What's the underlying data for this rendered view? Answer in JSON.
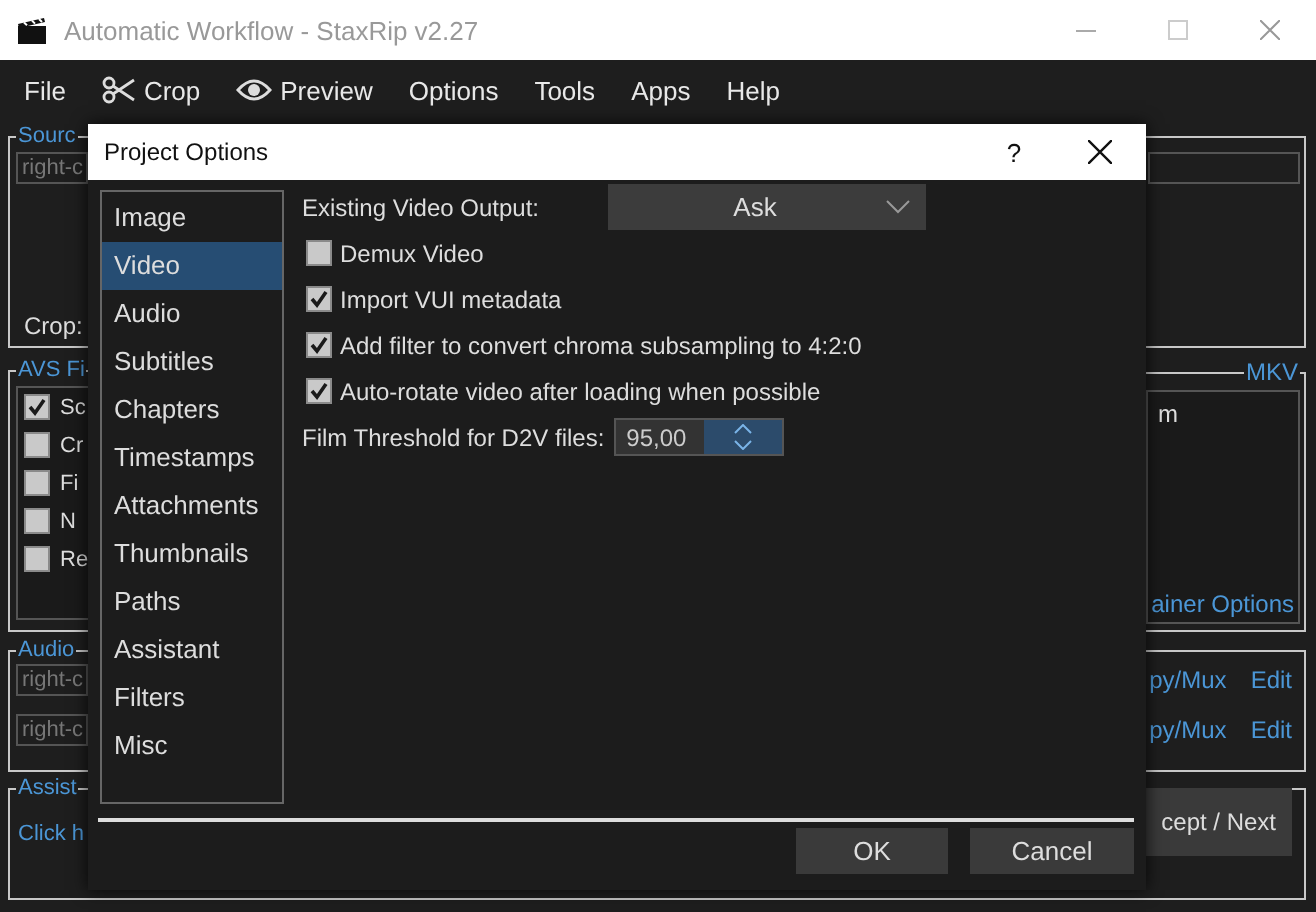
{
  "window": {
    "title": "Automatic Workflow - StaxRip v2.27"
  },
  "menu": [
    "File",
    "Crop",
    "Preview",
    "Options",
    "Tools",
    "Apps",
    "Help"
  ],
  "main": {
    "source": {
      "title": "Sourc",
      "field": "right-c",
      "crop_label": "Crop:"
    },
    "filters": {
      "title": "AVS Fi",
      "items": [
        {
          "label": "Sc",
          "checked": true
        },
        {
          "label": "Cr",
          "checked": false
        },
        {
          "label": "Fi",
          "checked": false
        },
        {
          "label": "N",
          "checked": false
        },
        {
          "label": "Re",
          "checked": false
        }
      ]
    },
    "container": {
      "title": "MKV",
      "items": [
        "m"
      ],
      "link": "ainer Options"
    },
    "audio": {
      "title": "Audio",
      "rows": [
        {
          "field": "right-c",
          "action": "py/Mux",
          "edit": "Edit"
        },
        {
          "field": "right-c",
          "action": "py/Mux",
          "edit": "Edit"
        }
      ]
    },
    "assistant": {
      "title": "Assist",
      "link": "Click h",
      "button": "cept / Next"
    }
  },
  "dialog": {
    "title": "Project Options",
    "help": "?",
    "pages": [
      {
        "label": "Image",
        "selected": false
      },
      {
        "label": "Video",
        "selected": true
      },
      {
        "label": "Audio",
        "selected": false
      },
      {
        "label": "Subtitles",
        "selected": false
      },
      {
        "label": "Chapters",
        "selected": false
      },
      {
        "label": "Timestamps",
        "selected": false
      },
      {
        "label": "Attachments",
        "selected": false
      },
      {
        "label": "Thumbnails",
        "selected": false
      },
      {
        "label": "Paths",
        "selected": false
      },
      {
        "label": "Assistant",
        "selected": false
      },
      {
        "label": "Filters",
        "selected": false
      },
      {
        "label": "Misc",
        "selected": false
      }
    ],
    "output_label": "Existing Video Output:",
    "output_value": "Ask",
    "options": [
      {
        "label": "Demux Video",
        "checked": false
      },
      {
        "label": "Import VUI metadata",
        "checked": true
      },
      {
        "label": "Add filter to convert chroma subsampling to 4:2:0",
        "checked": true
      },
      {
        "label": "Auto-rotate video after loading when possible",
        "checked": true
      }
    ],
    "threshold_label": "Film Threshold for D2V files:",
    "threshold_value": "95,00",
    "buttons": [
      "OK",
      "Cancel"
    ]
  }
}
